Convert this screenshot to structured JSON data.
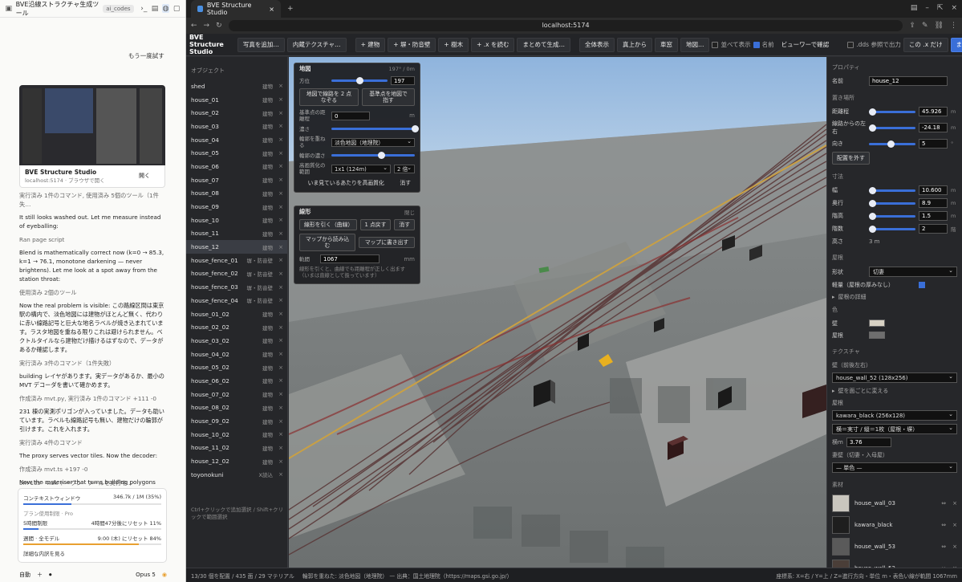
{
  "chat": {
    "title": "BVE沿線ストラクチャ生成ツール",
    "tag": "ai_codes",
    "retry": "もう一度試す",
    "preview_title": "BVE Structure Studio",
    "preview_url": "localhost:5174 · ブラウザで開く",
    "preview_open": "開く",
    "messages": [
      {
        "type": "meta",
        "text": "実行済み 1件のコマンド, 使用済み 5個のツール（1件失…"
      },
      {
        "type": "p",
        "text": "It still looks washed out. Let me measure instead of eyeballing:"
      },
      {
        "type": "meta",
        "text": "Ran page script"
      },
      {
        "type": "p",
        "text": "Blend is mathematically correct now (k=0 → 85.3, k=1 → 76.1, monotone darkening — never brightens). Let me look at a spot away from the station throat:"
      },
      {
        "type": "meta",
        "text": "使用済み 2個のツール"
      },
      {
        "type": "p",
        "text": "Now the real problem is visible: この路線区間は東京駅の構内で、淡色地図には建物がほとんど無く、代わりに赤い線路記号と巨大な地名ラベルが焼き込まれています。ラスタ地図を重ねる限りこれは避けられません。ベクトルタイルなら建物だけ描けるはずなので、データがあるか確認します。"
      },
      {
        "type": "meta",
        "text": "実行済み 3件のコマンド（1件失敗）"
      },
      {
        "type": "p",
        "text": "building レイヤがあります。実データがあるか、最小の MVT デコーダを書いて確かめます。"
      },
      {
        "type": "meta",
        "text": "作成済み mvt.py, 実行済み 1件のコマンド +111 -0"
      },
      {
        "type": "p",
        "text": "231 棟の実測ポリゴンが入っていました。データも助いています。ラベルも線路記号も無い、建物だけの輪郭が引けます。これを入れます。"
      },
      {
        "type": "meta",
        "text": "実行済み 4件のコマンド"
      },
      {
        "type": "p",
        "text": "The proxy serves vector tiles. Now the decoder:"
      },
      {
        "type": "meta",
        "text": "作成済み mvt.ts +197 -0"
      },
      {
        "type": "p",
        "text": "Now the rasteriser that turns building polygons into an overlay image:"
      },
      {
        "type": "meta",
        "text": "作成中"
      }
    ],
    "status": "5m 16s · 4.9k トークン · ツールを実行中…",
    "usage": {
      "context_label": "コンテキストウィンドウ",
      "context_value": "346.7k / 1M (35%)",
      "context_pct": 35,
      "plan_label": "プラン使用制限 · Pro",
      "limit5h_label": "5時間制限",
      "limit5h_value": "4時間47分後にリセット  11%",
      "limit5h_pct": 11,
      "weekly_label": "週間 · 全モデル",
      "weekly_value": "9:00 (木) にリセット  84%",
      "weekly_pct": 84,
      "detail": "詳細な内訳を見る"
    },
    "footer_left": "自動",
    "footer_model": "Opus 5"
  },
  "browser": {
    "tab_title": "BVE Structure Studio",
    "url": "localhost:5174"
  },
  "toolbar": {
    "brand": "BVE Structure Studio",
    "buttons": [
      "写真を追加…",
      "内蔵テクスチャ…",
      "+ 建物",
      "+ 塀・防音壁",
      "+ 樹木",
      "+ .x を読む",
      "まとめて生成…",
      "全体表示",
      "真上から",
      "車窓",
      "地図…"
    ],
    "chk_all": "並べて表示",
    "chk_name": "名前",
    "viewer": "ビューワーで確認",
    "dds": ".dds 参照で出力",
    "only_x": "この .x だけ",
    "export_all": "まとめて書き出し",
    "save": "保存",
    "open": "開く"
  },
  "objects": {
    "header": "オブジェクト",
    "items": [
      {
        "name": "shed",
        "type": "建物"
      },
      {
        "name": "house_01",
        "type": "建物"
      },
      {
        "name": "house_02",
        "type": "建物"
      },
      {
        "name": "house_03",
        "type": "建物"
      },
      {
        "name": "house_04",
        "type": "建物"
      },
      {
        "name": "house_05",
        "type": "建物"
      },
      {
        "name": "house_06",
        "type": "建物"
      },
      {
        "name": "house_07",
        "type": "建物"
      },
      {
        "name": "house_08",
        "type": "建物"
      },
      {
        "name": "house_09",
        "type": "建物"
      },
      {
        "name": "house_10",
        "type": "建物"
      },
      {
        "name": "house_11",
        "type": "建物"
      },
      {
        "name": "house_12",
        "type": "建物"
      },
      {
        "name": "house_fence_01",
        "type": "塀・防音壁"
      },
      {
        "name": "house_fence_02",
        "type": "塀・防音壁"
      },
      {
        "name": "house_fence_03",
        "type": "塀・防音壁"
      },
      {
        "name": "house_fence_04",
        "type": "塀・防音壁"
      },
      {
        "name": "house_01_02",
        "type": "建物"
      },
      {
        "name": "house_02_02",
        "type": "建物"
      },
      {
        "name": "house_03_02",
        "type": "建物"
      },
      {
        "name": "house_04_02",
        "type": "建物"
      },
      {
        "name": "house_05_02",
        "type": "建物"
      },
      {
        "name": "house_06_02",
        "type": "建物"
      },
      {
        "name": "house_07_02",
        "type": "建物"
      },
      {
        "name": "house_08_02",
        "type": "建物"
      },
      {
        "name": "house_09_02",
        "type": "建物"
      },
      {
        "name": "house_10_02",
        "type": "建物"
      },
      {
        "name": "house_11_02",
        "type": "建物"
      },
      {
        "name": "house_12_02",
        "type": "建物"
      },
      {
        "name": "toyonokuni",
        "type": "X読込"
      }
    ],
    "hint": "Ctrl+クリックで追加選択 / Shift+クリックで範囲選択"
  },
  "map_panel": {
    "title": "地図",
    "heading": "197° / 0m",
    "dir_label": "方位",
    "dir_value": "197",
    "dir_pct": 0.5,
    "btn_align": "地図で線路を 2 点なぞる",
    "btn_base": "基準点を地図で指す",
    "base_label": "基準点の距離程",
    "base_value": "0",
    "base_unit": "m",
    "dark_label": "濃さ",
    "dark_pct": 1.0,
    "overlay_label": "輪郭を重ねる",
    "overlay_value": "淡色地図（地理院）",
    "outline_label": "輪郭の濃さ",
    "outline_pct": 0.6,
    "hires_label": "高画質化の範囲",
    "hires_value": "1x1 (124m)",
    "hires_mult": "2 倍",
    "btn_hires": "いま見ているあたりを高画質化",
    "btn_clear": "消す"
  },
  "line_panel": {
    "title": "線形",
    "close": "閉じ",
    "btn_draw": "線形を引く（曲線）",
    "btn_undo": "1 点戻す",
    "btn_clear": "消す",
    "btn_load": "マップから読み込む",
    "btn_write": "マップに書き出す",
    "gauge_label": "軌間",
    "gauge_value": "1067",
    "gauge_unit": "mm",
    "note": "線形を引くと、曲線でも距離程が正しく出ます（いまは直線として扱っています）"
  },
  "props": {
    "header": "プロパティ",
    "name_label": "名前",
    "name_value": "house_12",
    "place_label": "置き場所",
    "dist_label": "距離程",
    "dist_value": "45.926",
    "dist_unit": "m",
    "lr_label": "線路からの左右",
    "lr_value": "-24.18",
    "lr_unit": "m",
    "dir_label": "向き",
    "dir_value": "5",
    "dir_unit": "°",
    "btn_unplace": "配置を外す",
    "size_label": "寸法",
    "w_label": "幅",
    "w_value": "10.600",
    "w_unit": "m",
    "d_label": "奥行",
    "d_value": "8.9",
    "d_unit": "m",
    "h_label": "階高",
    "h_value": "1.5",
    "h_unit": "m",
    "f_label": "階数",
    "f_value": "2",
    "f_unit": "階",
    "height_label": "高さ",
    "height_value": "3 m",
    "roof_label": "屋根",
    "shape_label": "形状",
    "shape_value": "切妻",
    "light_label": "軽量（屋根の厚みなし）",
    "roof_detail": "屋根の詳細",
    "color_label": "色",
    "wall_label": "壁",
    "wall_color": "#d8d2c4",
    "roofc_label": "屋根",
    "roof_color": "#6e6e6e",
    "tex_label": "テクスチャ",
    "wall_tex_label": "壁（前後左右）",
    "wall_tex_value": "house_wall_52 (128x256)",
    "per_face": "壁を面ごとに変える",
    "roof_tex_label": "屋根",
    "roof_tex_value": "kawara_black (256x128)",
    "map_mode": "横＝実寸 / 縦＝1枚（屋根・塀）",
    "w2_label": "横m",
    "w2_value": "3.76",
    "gable_label": "妻壁（切妻・入母屋）",
    "gable_value": "— 単色 —",
    "material_label": "素材",
    "materials": [
      {
        "name": "house_wall_03",
        "color": "#c9c6be"
      },
      {
        "name": "kawara_black",
        "color": "#1e1e1e"
      },
      {
        "name": "house_wall_53",
        "color": "#5a5a5a"
      },
      {
        "name": "house_wall_52",
        "color": "#4a3e38"
      }
    ]
  },
  "statusbar": {
    "left": "13/30 個を配置 / 435 面 / 29 マテリアル",
    "mid": "輪郭を重ねた: 淡色地図（地理院） — 出典：国土地理院（https://maps.gsi.go.jp/）",
    "right": "座標系: X=右 / Y=上 / Z=進行方向・単位 m・表色い線が軌間 1067mm"
  }
}
